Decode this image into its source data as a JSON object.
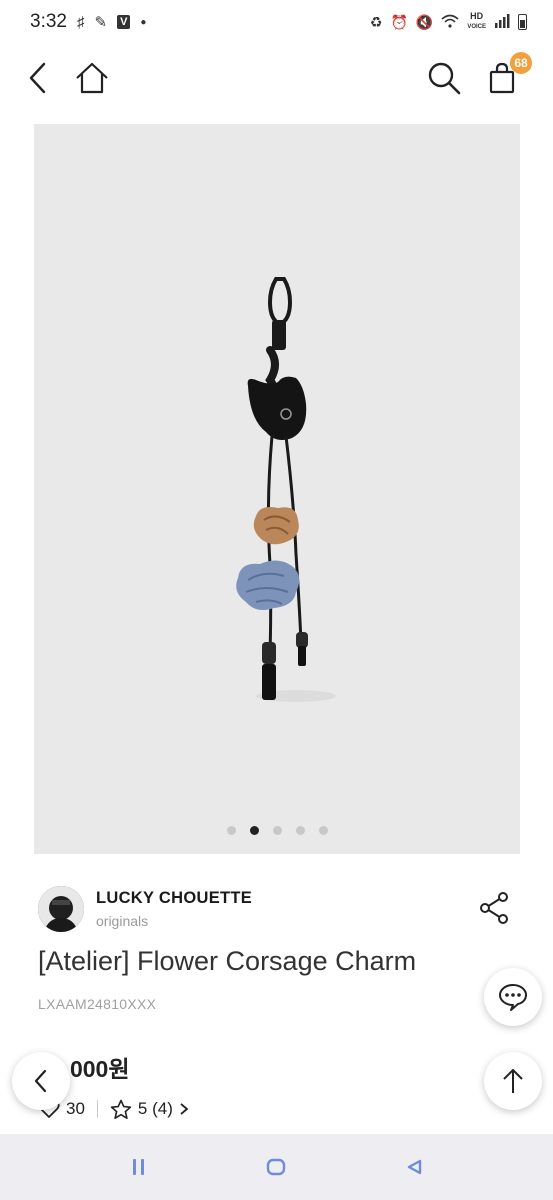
{
  "status_bar": {
    "time": "3:32",
    "left_icons": [
      "notification-icon",
      "edit-icon",
      "app-icon",
      "dot-icon"
    ],
    "hd_label": "HD",
    "hd_sub": "VOICE",
    "right_icons": [
      "recycle-icon",
      "alarm-icon",
      "mute-icon",
      "wifi-icon",
      "signal-icon",
      "battery-icon"
    ]
  },
  "header": {
    "cart_count": "68",
    "badge_color": "#f2a03d"
  },
  "product": {
    "carousel": {
      "total": 5,
      "active_index": 1
    },
    "brand_name": "LUCKY CHOUETTE",
    "brand_sub": "originals",
    "title": "[Atelier] Flower Corsage Charm",
    "code": "LXAAM24810XXX",
    "price": "98,000원",
    "likes": "30",
    "rating": "5 (4)"
  },
  "colors": {
    "image_bg": "#e9e9e9",
    "nav_bg": "#ededf2",
    "nav_icon": "#6f8cd8"
  }
}
